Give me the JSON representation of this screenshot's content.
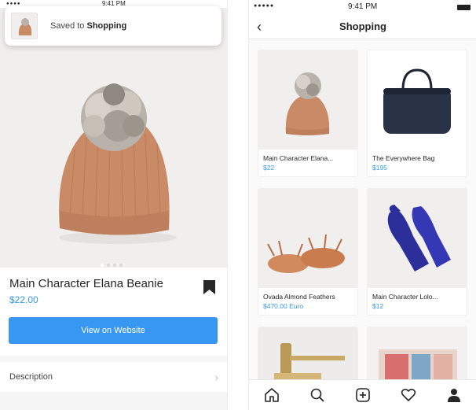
{
  "left": {
    "status_time": "9:41 PM",
    "toast": {
      "prefix": "Saved to ",
      "collection": "Shopping"
    },
    "product": {
      "title": "Main Character Elana Beanie",
      "price": "$22.00",
      "button_label": "View on Website",
      "description_label": "Description"
    },
    "carousel": {
      "count": 4,
      "active": 0
    }
  },
  "right": {
    "status_time": "9:41 PM",
    "title": "Shopping",
    "products": [
      {
        "name": "Main Character Elana...",
        "price": "$22"
      },
      {
        "name": "The Everywhere Bag",
        "price": "$195"
      },
      {
        "name": "Ovada Almond Feathers",
        "price": "$470.00 Euro"
      },
      {
        "name": "Main Character Lolo...",
        "price": "$12"
      }
    ],
    "tabs": [
      "home-icon",
      "search-icon",
      "add-icon",
      "heart-icon",
      "profile-icon"
    ]
  },
  "colors": {
    "accent": "#3897f0",
    "text": "#262626"
  }
}
